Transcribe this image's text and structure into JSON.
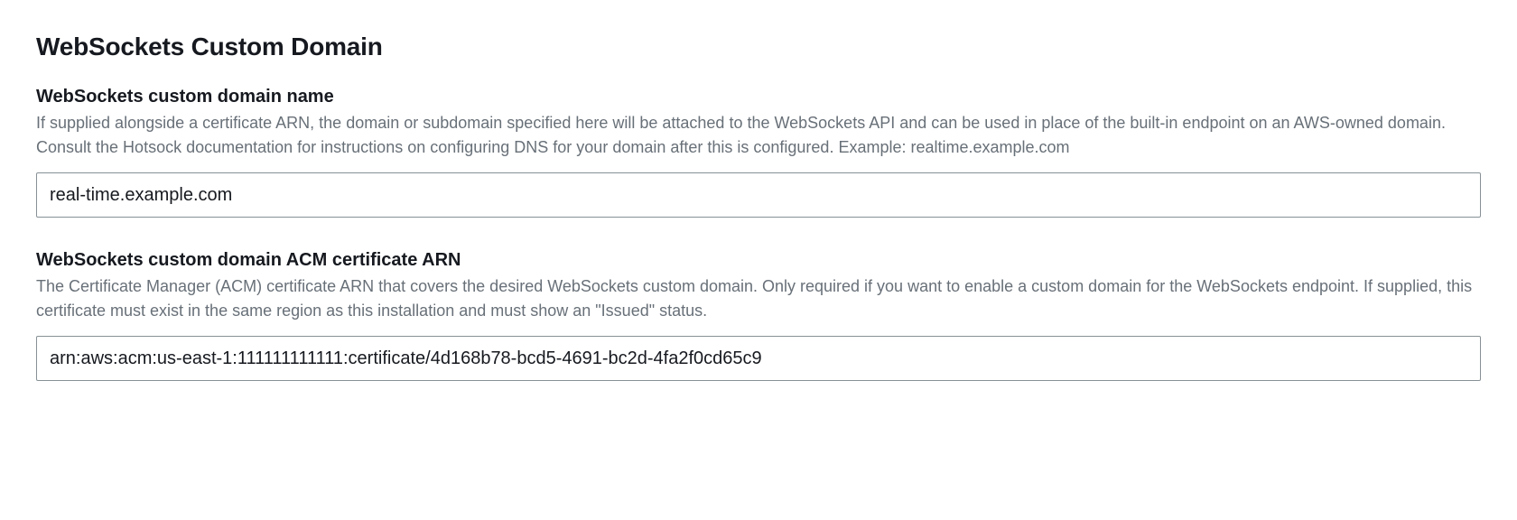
{
  "section": {
    "title": "WebSockets Custom Domain"
  },
  "fields": {
    "domain_name": {
      "label": "WebSockets custom domain name",
      "description": "If supplied alongside a certificate ARN, the domain or subdomain specified here will be attached to the WebSockets API and can be used in place of the built-in endpoint on an AWS-owned domain. Consult the Hotsock documentation for instructions on configuring DNS for your domain after this is configured. Example: realtime.example.com",
      "value": "real-time.example.com"
    },
    "acm_arn": {
      "label": "WebSockets custom domain ACM certificate ARN",
      "description": "The Certificate Manager (ACM) certificate ARN that covers the desired WebSockets custom domain. Only required if you want to enable a custom domain for the WebSockets endpoint. If supplied, this certificate must exist in the same region as this installation and must show an \"Issued\" status.",
      "value": "arn:aws:acm:us-east-1:111111111111:certificate/4d168b78-bcd5-4691-bc2d-4fa2f0cd65c9"
    }
  }
}
